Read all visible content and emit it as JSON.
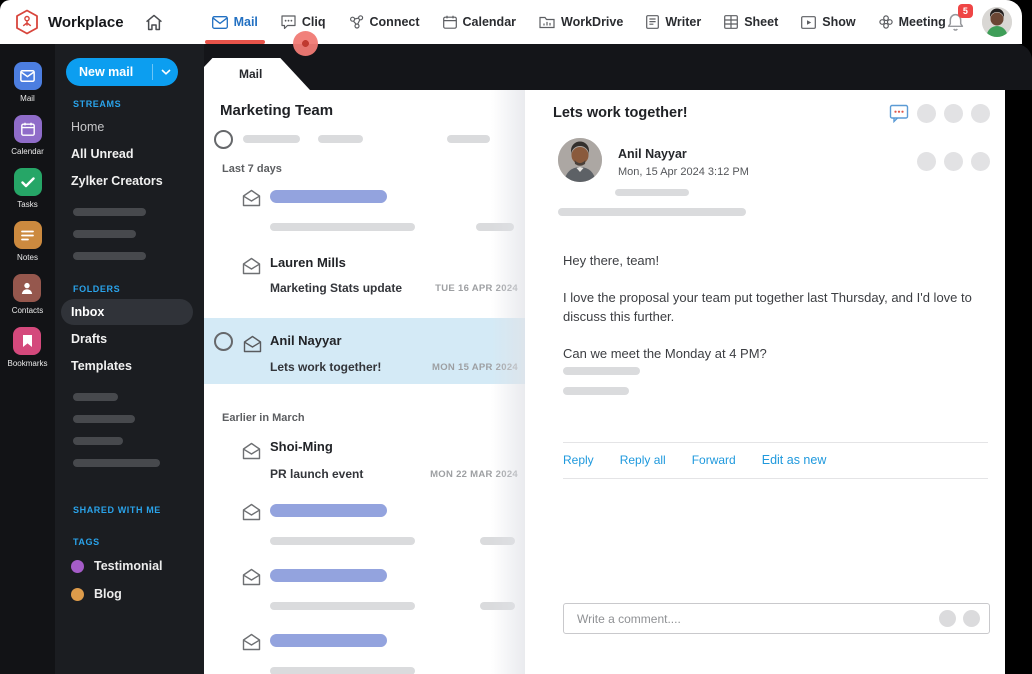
{
  "colors": {
    "accent_blue": "#0c9ef0",
    "link_blue": "#1f99dd",
    "active_nav_blue": "#2270c2",
    "underline_red": "#e8544a",
    "badge_red": "#ef4545",
    "selected_row_blue": "#d4eaf6",
    "skeleton_blue": "#93a3de"
  },
  "topbar": {
    "brand": "Workplace",
    "nav": [
      {
        "label": "Mail",
        "active": true
      },
      {
        "label": "Cliq"
      },
      {
        "label": "Connect"
      },
      {
        "label": "Calendar"
      },
      {
        "label": "WorkDrive"
      },
      {
        "label": "Writer"
      },
      {
        "label": "Sheet"
      },
      {
        "label": "Show"
      },
      {
        "label": "Meeting"
      }
    ],
    "notification_count": "5"
  },
  "app_rail": [
    {
      "label": "Mail",
      "color": "#4c7ee0"
    },
    {
      "label": "Calendar",
      "color": "#8f6cc9"
    },
    {
      "label": "Tasks",
      "color": "#26a667"
    },
    {
      "label": "Notes",
      "color": "#cc8a3f"
    },
    {
      "label": "Contacts",
      "color": "#95574d"
    },
    {
      "label": "Bookmarks",
      "color": "#d4497c"
    }
  ],
  "sidebar": {
    "new_mail": "New mail",
    "streams_header": "STREAMS",
    "streams": [
      "Home",
      "All Unread",
      "Zylker Creators"
    ],
    "folders_header": "FOLDERS",
    "folders": [
      "Inbox",
      "Drafts",
      "Templates"
    ],
    "selected_folder": "Inbox",
    "shared_header": "SHARED WITH ME",
    "tags_header": "TAGS",
    "tags": [
      {
        "label": "Testimonial",
        "color": "#a55cc8"
      },
      {
        "label": "Blog",
        "color": "#dd9b4a"
      }
    ]
  },
  "mail_list": {
    "tab": "Mail",
    "title": "Marketing Team",
    "groups": [
      {
        "label": "Last 7 days",
        "emails": [
          {
            "sender": "Lauren Mills",
            "subject": "Marketing Stats update",
            "date": "TUE 16 APR 2024"
          },
          {
            "sender": "Anil Nayyar",
            "subject": "Lets work together!",
            "date": "MON 15 APR 2024",
            "selected": true
          }
        ]
      },
      {
        "label": "Earlier in March",
        "emails": [
          {
            "sender": "Shoi-Ming",
            "subject": "PR launch event",
            "date": "MON 22 MAR 2024"
          }
        ]
      }
    ]
  },
  "reading_pane": {
    "subject": "Lets work together!",
    "sender": "Anil Nayyar",
    "datetime": "Mon,  15 Apr 2024  3:12 PM",
    "body": [
      "Hey there, team!",
      "I love the proposal your team put together last Thursday, and I'd love to discuss this further.",
      "Can we meet the Monday at 4 PM?"
    ],
    "actions": [
      "Reply",
      "Reply all",
      "Forward",
      "Edit as new"
    ],
    "comment_placeholder": "Write a comment...."
  }
}
